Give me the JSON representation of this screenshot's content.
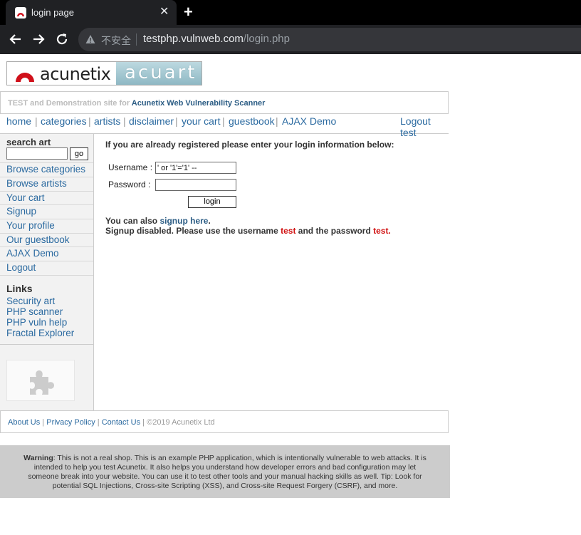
{
  "browser": {
    "tab_title": "login page",
    "new_tab_glyph": "+",
    "close_glyph": "✕",
    "security_label": "不安全",
    "url_host": "testphp.vulnweb.com",
    "url_path": "/login.php",
    "icons": [
      "back-icon",
      "forward-icon",
      "reload-icon",
      "warning-icon",
      "favicon-icon"
    ]
  },
  "logo": {
    "left_text": "acunetix",
    "right_text": "acuart"
  },
  "banner": {
    "prefix": "TEST and Demonstration site for ",
    "link": "Acunetix Web Vulnerability Scanner"
  },
  "nav": {
    "home": "home",
    "categories": "categories",
    "artists": "artists",
    "disclaimer": "disclaimer",
    "cart": "your cart",
    "guestbook": "guestbook",
    "ajax": "AJAX Demo",
    "logout": "Logout test",
    "separator": "|"
  },
  "sidebar": {
    "search_label": "search art",
    "search_value": "",
    "go_label": "go",
    "items": [
      {
        "label": "Browse categories"
      },
      {
        "label": "Browse artists"
      },
      {
        "label": "Your cart"
      },
      {
        "label": "Signup"
      },
      {
        "label": "Your profile"
      },
      {
        "label": "Our guestbook"
      },
      {
        "label": "AJAX Demo"
      },
      {
        "label": "Logout"
      }
    ],
    "links_title": "Links",
    "links": [
      {
        "label": "Security art"
      },
      {
        "label": "PHP scanner"
      },
      {
        "label": "PHP vuln help"
      },
      {
        "label": "Fractal Explorer"
      }
    ]
  },
  "login": {
    "intro": "If you are already registered please enter your login information below:",
    "username_label": "Username :",
    "username_value": "' or '1'='1' --",
    "password_label": "Password :",
    "password_value": "",
    "button": "login",
    "signup_prefix": "You can also ",
    "signup_link": "signup here",
    "signup_suffix": ".",
    "disabled_prefix": "Signup disabled. Please use the username ",
    "username_hint": "test",
    "disabled_middle": " and the password ",
    "password_hint": "test",
    "disabled_suffix": "."
  },
  "footer": {
    "about": "About Us",
    "privacy": "Privacy Policy",
    "contact": "Contact Us",
    "sep": " | ",
    "copyright": "©2019 Acunetix Ltd"
  },
  "warning": {
    "label": "Warning",
    "text": ": This is not a real shop. This is an example PHP application, which is intentionally vulnerable to web attacks. It is intended to help you test Acunetix. It also helps you understand how developer errors and bad configuration may let someone break into your website. You can use it to test other tools and your manual hacking skills as well. Tip: Look for potential SQL Injections, Cross-site Scripting (XSS), and Cross-site Request Forgery (CSRF), and more."
  },
  "colors": {
    "link": "#2b6aa0",
    "banner_link": "#2b5c84",
    "hint_red": "#d01010",
    "chrome_bg": "#202124"
  }
}
